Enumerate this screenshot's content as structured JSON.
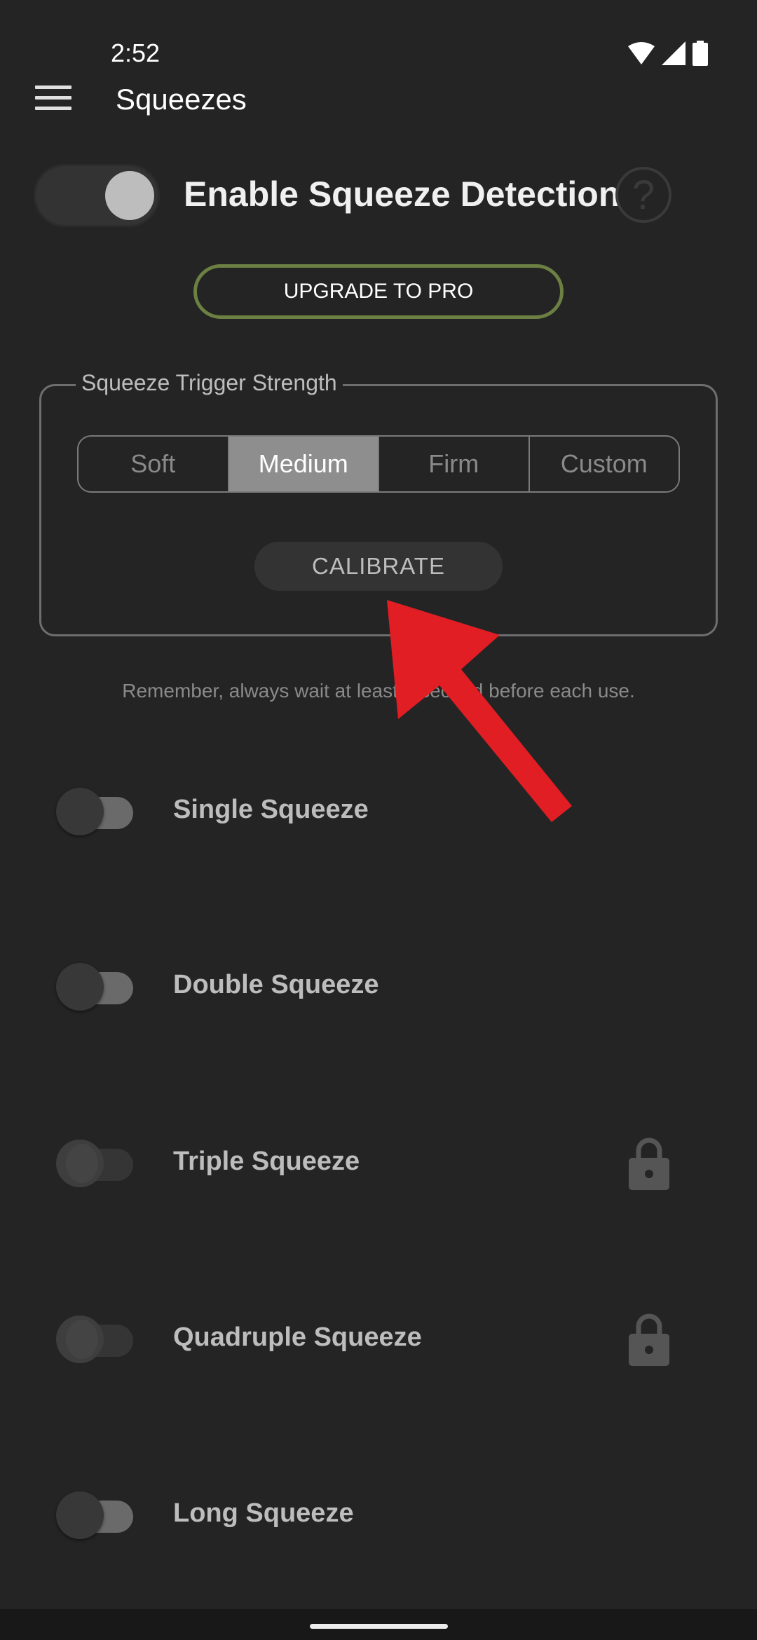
{
  "status_bar": {
    "time": "2:52",
    "icons": [
      "wifi-icon",
      "cell-signal-icon",
      "battery-icon"
    ]
  },
  "app_bar": {
    "menu_icon": "hamburger-menu-icon",
    "title": "Squeezes"
  },
  "master": {
    "label": "Enable Squeeze Detection",
    "enabled": true,
    "help_icon": "?"
  },
  "upgrade": {
    "label": "UPGRADE TO PRO",
    "accent": "#6b8042"
  },
  "trigger_strength": {
    "legend": "Squeeze Trigger Strength",
    "options": [
      "Soft",
      "Medium",
      "Firm",
      "Custom"
    ],
    "selected": "Medium",
    "calibrate_label": "CALIBRATE"
  },
  "hint": "Remember, always wait at least 1 second before each use.",
  "squeezes": [
    {
      "label": "Single Squeeze",
      "enabled": false,
      "locked": false
    },
    {
      "label": "Double Squeeze",
      "enabled": false,
      "locked": false
    },
    {
      "label": "Triple Squeeze",
      "enabled": false,
      "locked": true
    },
    {
      "label": "Quadruple Squeeze",
      "enabled": false,
      "locked": true
    },
    {
      "label": "Long Squeeze",
      "enabled": false,
      "locked": false
    }
  ],
  "annotation": {
    "type": "arrow",
    "color": "#e01e24",
    "points_to": "calibrate-button"
  }
}
